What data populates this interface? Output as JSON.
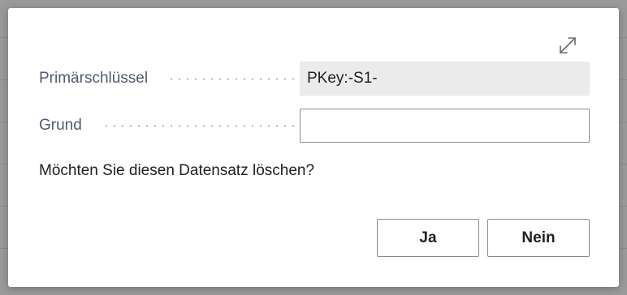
{
  "dialog": {
    "fields": [
      {
        "label": "Primärschlüssel",
        "value": "PKey:-S1-",
        "readonly": true
      },
      {
        "label": "Grund",
        "value": "",
        "readonly": false
      }
    ],
    "question": "Möchten Sie diesen Datensatz löschen?",
    "buttons": {
      "yes": "Ja",
      "no": "Nein"
    },
    "expand_icon": "expand-diagonal-arrows"
  }
}
